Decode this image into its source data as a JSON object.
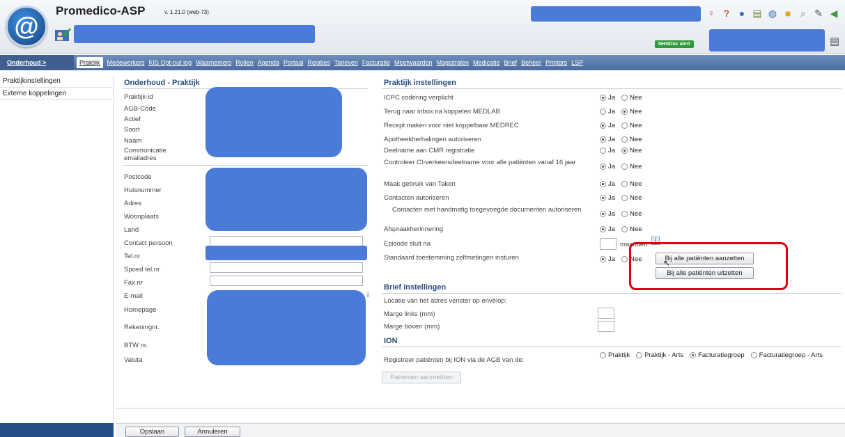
{
  "app": {
    "title": "Promedico-ASP",
    "version": "v. 1.21.0 (web-73)",
    "badge": "NHGDoc alert"
  },
  "toolbar_icons": [
    "person-icon",
    "help-icon",
    "globe-icon",
    "notes-icon",
    "world-icon",
    "folder-icon",
    "document-search-icon",
    "pen-icon",
    "back-icon"
  ],
  "nav": {
    "home": "Onderhoud >",
    "items": [
      "Praktijk",
      "Medewerkers",
      "KIS Opt-out log",
      "Waarnemers",
      "Rollen",
      "Agenda",
      "Portaal",
      "Relaties",
      "Tarieven",
      "Facturatie",
      "Meetwaarden",
      "Magistralen",
      "Medicatie",
      "Brief",
      "Beheer",
      "Printers",
      "LSP"
    ]
  },
  "sidebar": {
    "items": [
      "Praktijkinstellingen",
      "Externe koppelingen"
    ]
  },
  "left_panel": {
    "title": "Onderhoud - Praktijk",
    "fields": [
      "Praktijk-id",
      "AGB-Code",
      "Actief",
      "Soort",
      "Naam",
      "Communicatie emailadres",
      "Postcode",
      "Huisnummer",
      "Adres",
      "Woonplaats",
      "Land",
      "Contact persoon",
      "Tel.nr",
      "Spoed tel.nr",
      "Fax.nr",
      "E-mail",
      "Homepage",
      "Rekeningnr.",
      "BTW nr.",
      "Valuta"
    ],
    "info_marker": "i"
  },
  "praktijk_instellingen": {
    "title": "Praktijk instellingen",
    "yes": "Ja",
    "no": "Nee",
    "settings": [
      {
        "label": "ICPC codering verplicht",
        "value": "Ja"
      },
      {
        "label": "Terug naar inbox na koppelen MEDLAB",
        "value": "Nee"
      },
      {
        "label": "Recept maken voor niet koppelbaar MEDREC",
        "value": "Ja"
      },
      {
        "label": "Apotheekherhalingen autoriseren",
        "value": "Ja"
      },
      {
        "label": "Deelname aan CMR registratie",
        "value": "Nee"
      },
      {
        "label": "Controleer CI-verkeersdeelname voor alle patiënten vanaf 16 jaar",
        "value": "Ja"
      },
      {
        "label": "Maak gebruik van Taken",
        "value": "Ja"
      },
      {
        "label": "Contacten autoriseren",
        "value": "Ja"
      },
      {
        "label": "Contacten met handmatig toegevoegde documenten autoriseren",
        "value": "Ja"
      },
      {
        "label": "Afspraakherinnering",
        "value": "Ja"
      }
    ],
    "episode_label": "Episode sluit na",
    "episode_unit": "maanden",
    "zelfmetingen_label": "Standaard toestemming zelfmetingen insturen",
    "zelfmetingen_value": "Ja",
    "btn_aanzetten": "Bij alle patiënten aanzetten",
    "btn_uitzetten": "Bij alle patiënten uitzetten"
  },
  "brief_instellingen": {
    "title": "Brief instellingen",
    "locatie_label": "Locatie van het adres venster op envelop:",
    "marge_links": "Marge links (mm)",
    "marge_boven": "Marge boven (mm)"
  },
  "ion": {
    "title": "ION",
    "label": "Registreer patiënten bij ION via de AGB van de:",
    "options": [
      "Praktijk",
      "Praktijk - Arts",
      "Facturatiegroep",
      "Facturatiegroep - Arts"
    ],
    "selected": "Facturatiegroep",
    "btn_aanmelden": "Patiënten aanmelden"
  },
  "footer": {
    "save": "Opslaan",
    "cancel": "Annuleren"
  }
}
